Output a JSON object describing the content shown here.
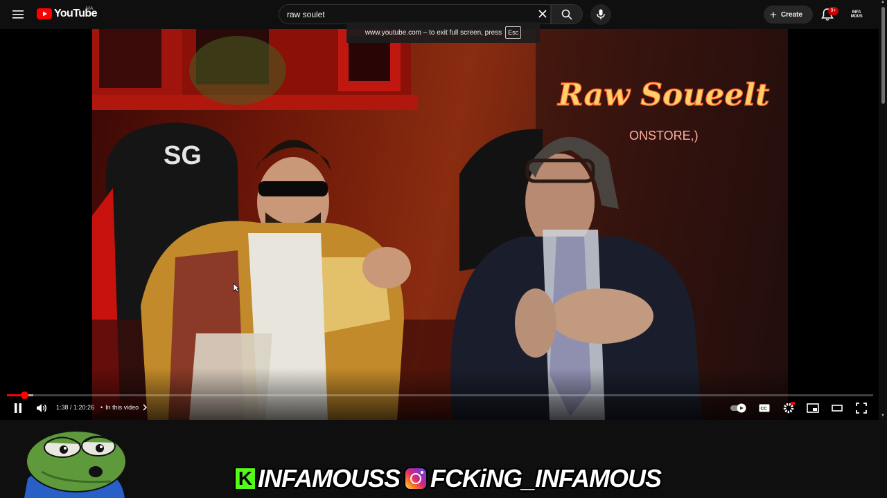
{
  "topbar": {
    "logo_text": "YouTube",
    "country_code": "MA",
    "search_value": "raw soulet",
    "fullscreen_hint": "www.youtube.com – to exit full screen, press",
    "esc_key": "Esc",
    "create_label": "Create",
    "notification_count": "9+",
    "avatar_line1": "INFA",
    "avatar_line2": "MOUS"
  },
  "video": {
    "neon_sign": "Raw Soueelt",
    "neon_sub": "ONSTORE,)",
    "chair_logo": "SG"
  },
  "player": {
    "time_display": "1:38 / 1:20:26",
    "chapter_label": "In this video",
    "progress_fraction": 0.02,
    "accent_color": "#ff0000"
  },
  "overlay": {
    "kick_letter": "K",
    "kick_handle": "INFAMOUSS",
    "instagram_handle": "FCKiNG_INFAMOUS"
  },
  "icons": [
    "menu-icon",
    "youtube-logo-icon",
    "close-icon",
    "search-icon",
    "mic-icon",
    "plus-icon",
    "bell-icon",
    "pause-icon",
    "volume-icon",
    "chevron-right-icon",
    "autoplay-toggle-icon",
    "captions-icon",
    "settings-icon",
    "miniplayer-icon",
    "theater-icon",
    "fullscreen-icon"
  ]
}
